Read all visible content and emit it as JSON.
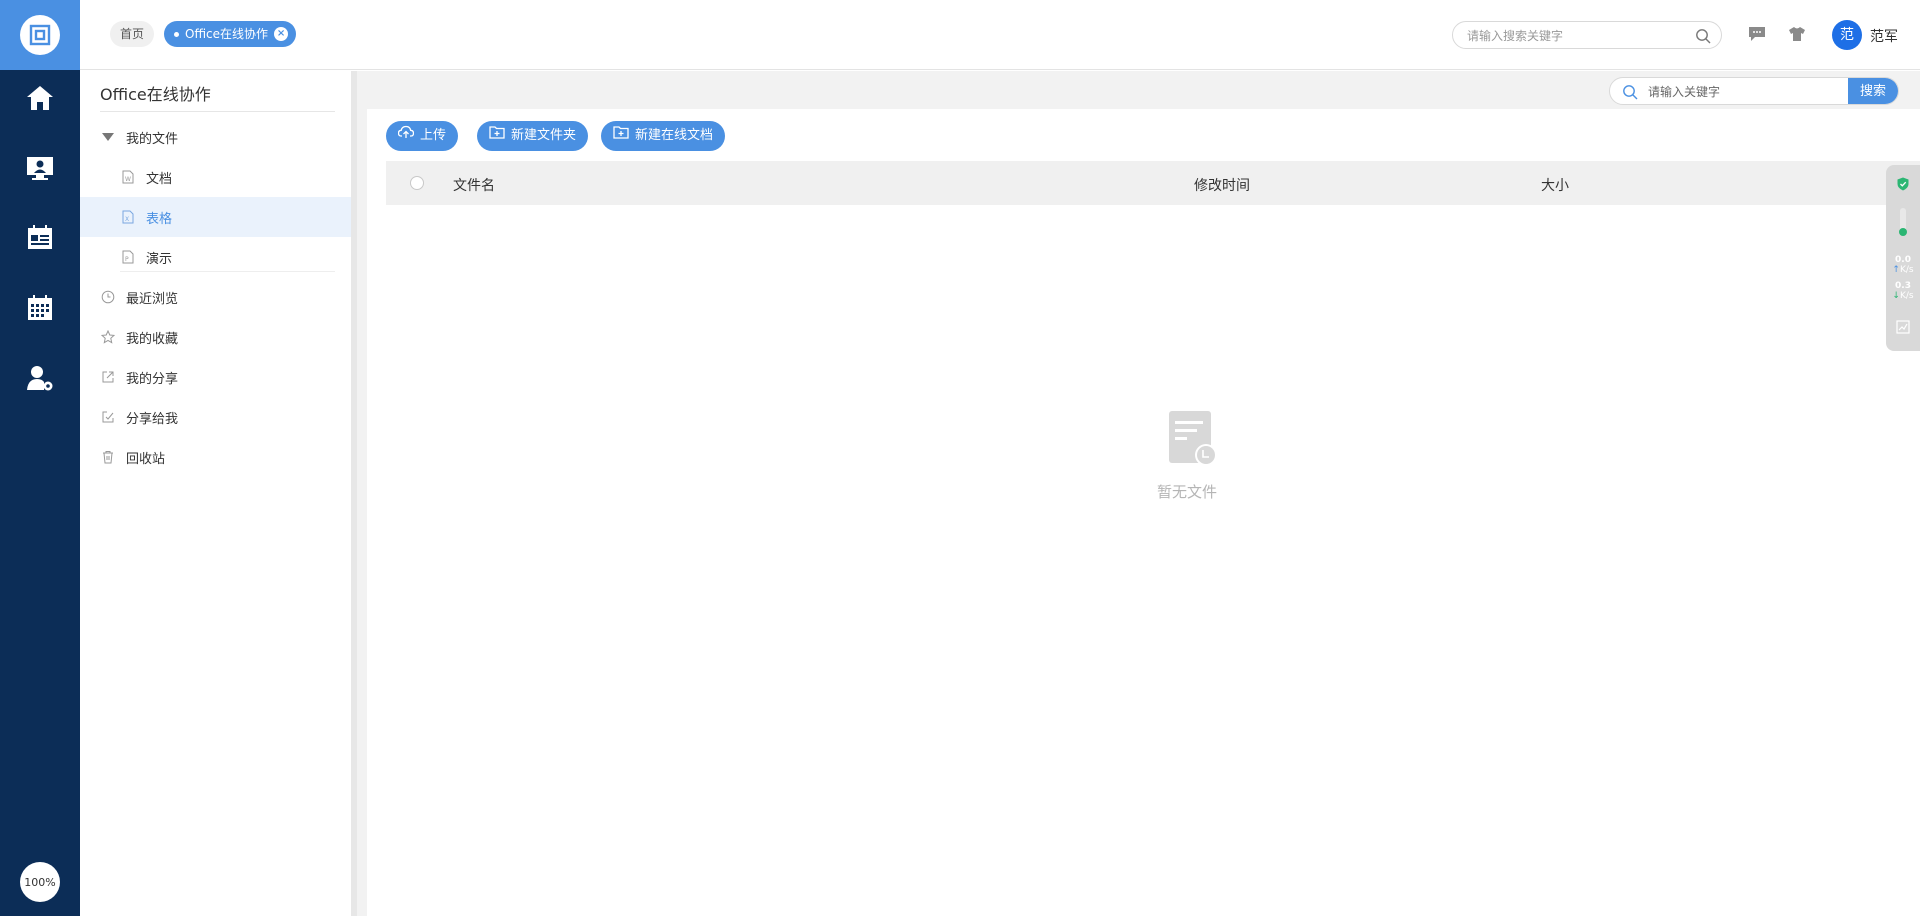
{
  "app": {
    "zoom": "100%"
  },
  "topbar": {
    "breadcrumbs": [
      {
        "label": "首页"
      },
      {
        "label": "Office在线协作"
      }
    ],
    "search_placeholder": "请输入搜索关键字",
    "user": {
      "avatar_text": "范",
      "name": "范军"
    }
  },
  "sidenav": {
    "title": "Office在线协作",
    "items": [
      {
        "label": "我的文件",
        "icon": "caret-down-icon"
      },
      {
        "label": "文档",
        "icon": "word-file-icon"
      },
      {
        "label": "表格",
        "icon": "excel-file-icon",
        "active": true
      },
      {
        "label": "演示",
        "icon": "ppt-file-icon"
      },
      {
        "label": "最近浏览",
        "icon": "clock-icon"
      },
      {
        "label": "我的收藏",
        "icon": "star-icon"
      },
      {
        "label": "我的分享",
        "icon": "share-out-icon"
      },
      {
        "label": "分享给我",
        "icon": "share-in-icon"
      },
      {
        "label": "回收站",
        "icon": "trash-icon"
      }
    ]
  },
  "main": {
    "search_placeholder": "请输入关键字",
    "search_button": "搜索",
    "actions": [
      {
        "label": "上传"
      },
      {
        "label": "新建文件夹"
      },
      {
        "label": "新建在线文档"
      }
    ],
    "columns": [
      "文件名",
      "修改时间",
      "大小"
    ],
    "empty_text": "暂无文件"
  },
  "widget": {
    "up_speed": "0.0",
    "up_unit": "K/s",
    "down_speed": "0.3",
    "down_unit": "K/s"
  },
  "colors": {
    "accent": "#4a90e2",
    "rail": "#0c2d57",
    "avatar": "#1e6fe6"
  }
}
